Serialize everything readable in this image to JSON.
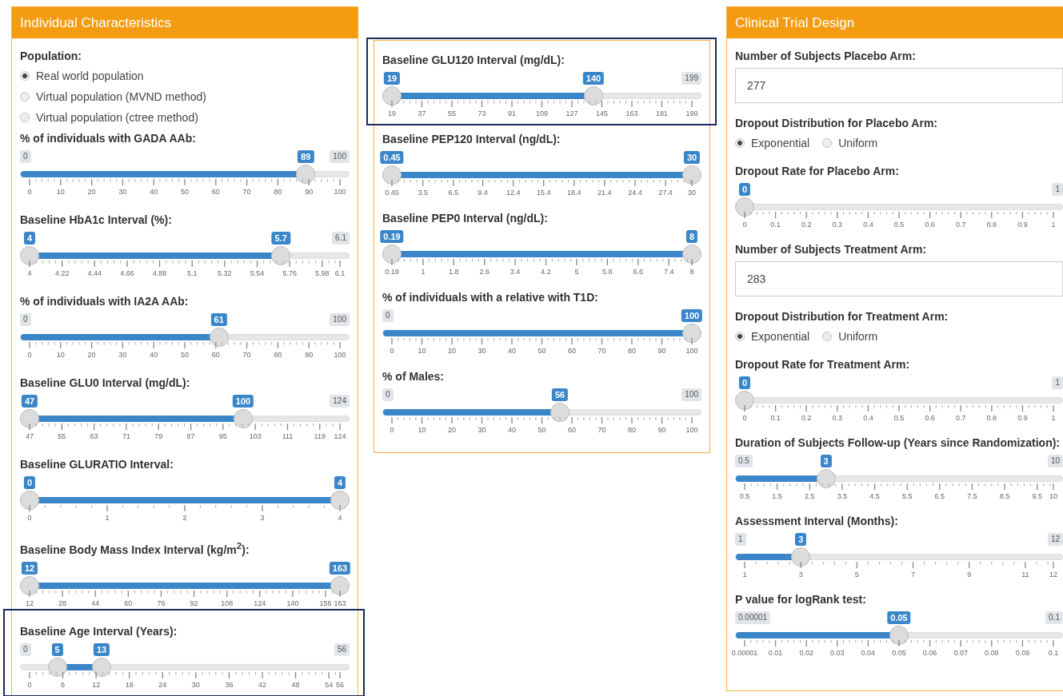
{
  "panels": [
    {
      "title": "Individual Characteristics",
      "controls": [
        {
          "kind": "radio",
          "label": "Population:",
          "inline": false,
          "options": [
            {
              "label": "Real world population",
              "selected": true
            },
            {
              "label": "Virtual population (MVND method)",
              "selected": false
            },
            {
              "label": "Virtual population (ctree method)",
              "selected": false
            }
          ]
        },
        {
          "kind": "slider",
          "label": "% of individuals with GADA AAb:",
          "highlighted": false,
          "min_label": "0",
          "max_label": "100",
          "handles": [
            {
              "value": "89",
              "level": 0.89
            }
          ],
          "ticks": [
            "0",
            "10",
            "20",
            "30",
            "40",
            "50",
            "60",
            "70",
            "80",
            "90",
            "100"
          ]
        },
        {
          "kind": "range_slider",
          "label": "Baseline HbA1c Interval (%):",
          "highlighted": false,
          "max_label": "6.1",
          "handles": [
            {
              "value": "4",
              "level": 0
            },
            {
              "value": "5.7",
              "level": 0.81
            }
          ],
          "ticks": [
            "4",
            "4.22",
            "4.44",
            "4.66",
            "4.88",
            "5.1",
            "5.32",
            "5.54",
            "5.76",
            "5.98",
            "6.1"
          ]
        },
        {
          "kind": "slider",
          "label": "% of individuals with IA2A AAb:",
          "highlighted": false,
          "min_label": "0",
          "max_label": "100",
          "handles": [
            {
              "value": "61",
              "level": 0.61
            }
          ],
          "ticks": [
            "0",
            "10",
            "20",
            "30",
            "40",
            "50",
            "60",
            "70",
            "80",
            "90",
            "100"
          ]
        },
        {
          "kind": "range_slider",
          "label": "Baseline GLU0 Interval (mg/dL):",
          "highlighted": false,
          "max_label": "124",
          "handles": [
            {
              "value": "47",
              "level": 0
            },
            {
              "value": "100",
              "level": 0.688
            }
          ],
          "ticks": [
            "47",
            "55",
            "63",
            "71",
            "79",
            "87",
            "95",
            "103",
            "111",
            "119",
            "124"
          ]
        },
        {
          "kind": "range_slider",
          "label": "Baseline GLURATIO Interval:",
          "highlighted": false,
          "handles": [
            {
              "value": "0",
              "level": 0
            },
            {
              "value": "4",
              "level": 1
            }
          ],
          "ticks": [
            "0",
            "1",
            "2",
            "3",
            "4"
          ]
        },
        {
          "kind": "range_slider",
          "label": "Baseline Body Mass Index Interval (kg/m$^{2}$):",
          "highlighted": false,
          "handles": [
            {
              "value": "12",
              "level": 0
            },
            {
              "value": "163",
              "level": 1
            }
          ],
          "ticks": [
            "12",
            "28",
            "44",
            "60",
            "76",
            "92",
            "108",
            "124",
            "140",
            "156",
            "163"
          ]
        },
        {
          "kind": "range_slider",
          "label": "Baseline Age Interval (Years):",
          "highlighted": true,
          "min_label": "0",
          "max_label": "56",
          "handles": [
            {
              "value": "5",
              "level": 0.089
            },
            {
              "value": "13",
              "level": 0.232
            }
          ],
          "ticks": [
            "0",
            "6",
            "12",
            "18",
            "24",
            "30",
            "36",
            "42",
            "48",
            "54",
            "56"
          ]
        }
      ]
    },
    {
      "controls": [
        {
          "kind": "range_slider",
          "label": "Baseline GLU120 Interval (mg/dL):",
          "highlighted": true,
          "max_label": "199",
          "handles": [
            {
              "value": "19",
              "level": 0
            },
            {
              "value": "140",
              "level": 0.672
            }
          ],
          "ticks": [
            "19",
            "37",
            "55",
            "73",
            "91",
            "109",
            "127",
            "145",
            "163",
            "181",
            "199"
          ]
        },
        {
          "kind": "range_slider",
          "label": "Baseline PEP120 Interval (ng/dL):",
          "highlighted": false,
          "handles": [
            {
              "value": "0.45",
              "level": 0
            },
            {
              "value": "30",
              "level": 1
            }
          ],
          "ticks": [
            "0.45",
            "3.5",
            "6.5",
            "9.4",
            "12.4",
            "15.4",
            "18.4",
            "21.4",
            "24.4",
            "27.4",
            "30"
          ]
        },
        {
          "kind": "range_slider",
          "label": "Baseline PEP0 Interval (ng/dL):",
          "highlighted": false,
          "handles": [
            {
              "value": "0.19",
              "level": 0
            },
            {
              "value": "8",
              "level": 1
            }
          ],
          "ticks": [
            "0.19",
            "1",
            "1.8",
            "2.6",
            "3.4",
            "4.2",
            "5",
            "5.8",
            "6.6",
            "7.4",
            "8"
          ]
        },
        {
          "kind": "slider",
          "label": "% of individuals with a relative with T1D:",
          "highlighted": false,
          "min_label": "0",
          "handles": [
            {
              "value": "100",
              "level": 1
            }
          ],
          "ticks": [
            "0",
            "10",
            "20",
            "30",
            "40",
            "50",
            "60",
            "70",
            "80",
            "90",
            "100"
          ]
        },
        {
          "kind": "slider",
          "label": "% of Males:",
          "highlighted": false,
          "min_label": "0",
          "max_label": "100",
          "handles": [
            {
              "value": "56",
              "level": 0.56
            }
          ],
          "ticks": [
            "0",
            "10",
            "20",
            "30",
            "40",
            "50",
            "60",
            "70",
            "80",
            "90",
            "100"
          ]
        }
      ]
    },
    {
      "title": "Clinical Trial Design",
      "controls": [
        {
          "kind": "number_input",
          "label": "Number of Subjects Placebo Arm:",
          "value": "277"
        },
        {
          "kind": "radio",
          "label": "Dropout Distribution for Placebo Arm:",
          "inline": true,
          "options": [
            {
              "label": "Exponential",
              "selected": true
            },
            {
              "label": "Uniform",
              "selected": false
            }
          ]
        },
        {
          "kind": "slider",
          "label": "Dropout Rate for Placebo Arm:",
          "highlighted": false,
          "max_label": "1",
          "handles": [
            {
              "value": "0",
              "level": 0
            }
          ],
          "ticks": [
            "0",
            "0.1",
            "0.2",
            "0.3",
            "0.4",
            "0.5",
            "0.6",
            "0.7",
            "0.8",
            "0.9",
            "1"
          ]
        },
        {
          "kind": "number_input",
          "label": "Number of Subjects Treatment Arm:",
          "value": "283"
        },
        {
          "kind": "radio",
          "label": "Dropout Distribution for Treatment Arm:",
          "inline": true,
          "options": [
            {
              "label": "Exponential",
              "selected": true
            },
            {
              "label": "Uniform",
              "selected": false
            }
          ]
        },
        {
          "kind": "slider",
          "label": "Dropout Rate for Treatment Arm:",
          "highlighted": false,
          "max_label": "1",
          "handles": [
            {
              "value": "0",
              "level": 0
            }
          ],
          "ticks": [
            "0",
            "0.1",
            "0.2",
            "0.3",
            "0.4",
            "0.5",
            "0.6",
            "0.7",
            "0.8",
            "0.9",
            "1"
          ]
        },
        {
          "kind": "slider",
          "label": "Duration of Subjects Follow-up (Years since Randomization):",
          "highlighted": false,
          "min_label": "0.5",
          "max_label": "10",
          "handles": [
            {
              "value": "3",
              "level": 0.263
            }
          ],
          "ticks": [
            "0.5",
            "1.5",
            "2.5",
            "3.5",
            "4.5",
            "5.5",
            "6.5",
            "7.5",
            "8.5",
            "9.5",
            "10"
          ]
        },
        {
          "kind": "slider",
          "label": "Assessment Interval (Months):",
          "highlighted": false,
          "min_label": "1",
          "max_label": "12",
          "handles": [
            {
              "value": "3",
              "level": 0.182
            }
          ],
          "ticks": [
            "1",
            "3",
            "5",
            "7",
            "9",
            "11",
            "12"
          ]
        },
        {
          "kind": "slider",
          "label": "P value for logRank test:",
          "highlighted": false,
          "min_label": "0.00001",
          "max_label": "0.1",
          "handles": [
            {
              "value": "0.05",
              "level": 0.5
            }
          ],
          "ticks": [
            "0.00001",
            "0.01",
            "0.02",
            "0.03",
            "0.04",
            "0.05",
            "0.06",
            "0.07",
            "0.08",
            "0.09",
            "0.1"
          ]
        }
      ]
    }
  ]
}
